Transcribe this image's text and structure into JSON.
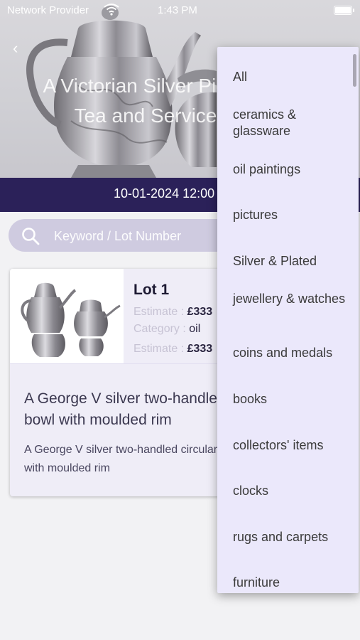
{
  "status_bar": {
    "carrier": "Network Provider",
    "time": "1:43 PM"
  },
  "header": {
    "back_icon": "chevron-left-icon",
    "title": "A Victorian Silver Piece Tea and Service"
  },
  "date_band": {
    "datetime": "10-01-2024 12:00"
  },
  "search": {
    "placeholder": "Keyword / Lot Number",
    "icon": "search-icon"
  },
  "lot_card": {
    "title": "Lot 1",
    "estimate_label": "Estimate :",
    "estimate_value": "£333",
    "category_label": "Category :",
    "category_value": "oil",
    "estimate2_label": "Estimate :",
    "estimate2_value": "£333",
    "description_title": "A George V silver two-handled bowl with moulded rim",
    "description_body": "A George V silver two-handled circular bowl with moulded rim"
  },
  "dropdown": {
    "items": [
      "All",
      "ceramics & glassware",
      "oil paintings",
      "pictures",
      "Silver & Plated",
      "jewellery & watches",
      "coins and medals",
      "books",
      "collectors' items",
      "clocks",
      "rugs and carpets",
      "furniture"
    ]
  },
  "colors": {
    "brand_dark": "#2b2159",
    "dropdown_bg": "#ebe8fb",
    "card_bg": "#efedf7",
    "search_bg": "#cfcbe0"
  }
}
